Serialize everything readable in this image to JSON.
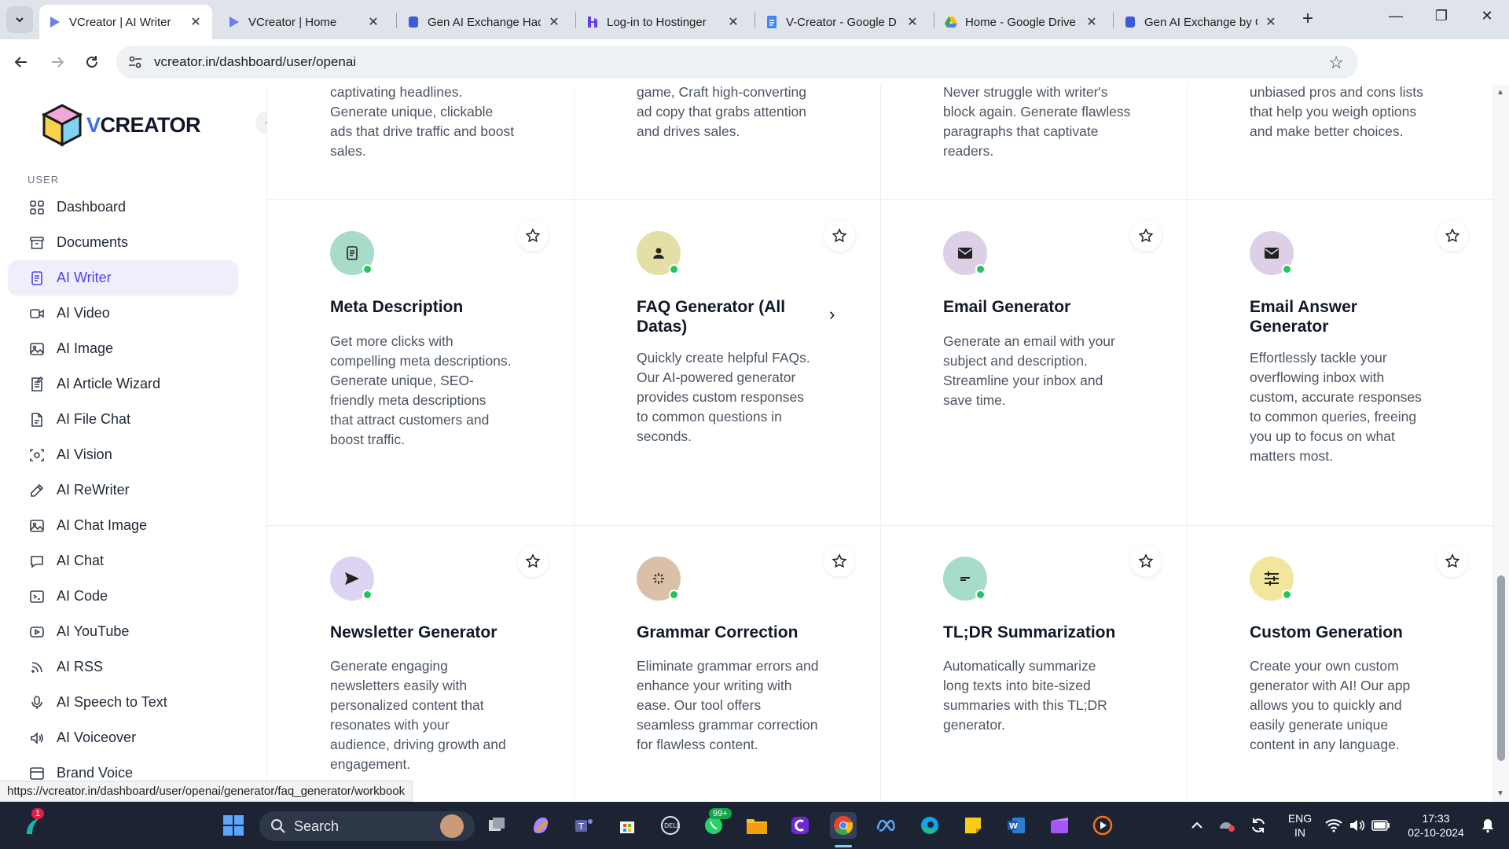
{
  "browser": {
    "tabs": [
      {
        "title": "VCreator | AI Writer",
        "active": true
      },
      {
        "title": "VCreator | Home",
        "active": false
      },
      {
        "title": "Gen AI Exchange Hac",
        "active": false
      },
      {
        "title": "Log-in to Hostinger",
        "active": false
      },
      {
        "title": "V-Creator - Google D",
        "active": false
      },
      {
        "title": "Home - Google Drive",
        "active": false
      },
      {
        "title": "Gen AI Exchange by G",
        "active": false
      }
    ],
    "url": "vcreator.in/dashboard/user/openai",
    "status_url": "https://vcreator.in/dashboard/user/openai/generator/faq_generator/workbook"
  },
  "sidebar": {
    "logo_text": "CREATOR",
    "logo_prefix": "V",
    "section_label": "USER",
    "items": [
      {
        "label": "Dashboard",
        "icon": "grid-icon"
      },
      {
        "label": "Documents",
        "icon": "archive-icon"
      },
      {
        "label": "AI Writer",
        "icon": "document-icon",
        "active": true
      },
      {
        "label": "AI Video",
        "icon": "video-icon"
      },
      {
        "label": "AI Image",
        "icon": "image-icon"
      },
      {
        "label": "AI Article Wizard",
        "icon": "article-icon"
      },
      {
        "label": "AI File Chat",
        "icon": "file-chat-icon"
      },
      {
        "label": "AI Vision",
        "icon": "vision-icon"
      },
      {
        "label": "AI ReWriter",
        "icon": "pen-icon"
      },
      {
        "label": "AI Chat Image",
        "icon": "image-icon"
      },
      {
        "label": "AI Chat",
        "icon": "chat-icon"
      },
      {
        "label": "AI Code",
        "icon": "terminal-icon"
      },
      {
        "label": "AI YouTube",
        "icon": "youtube-icon"
      },
      {
        "label": "AI RSS",
        "icon": "rss-icon"
      },
      {
        "label": "AI Speech to Text",
        "icon": "microphone-icon"
      },
      {
        "label": "AI Voiceover",
        "icon": "speaker-icon"
      },
      {
        "label": "Brand Voice",
        "icon": "brand-icon"
      }
    ]
  },
  "top_row_text": [
    "captivating headlines. Generate unique, clickable ads that drive traffic and boost sales.",
    "game, Craft high-converting ad copy that grabs attention and drives sales.",
    "Never struggle with writer's block again. Generate flawless paragraphs that captivate readers.",
    "unbiased pros and cons lists that help you weigh options and make better choices."
  ],
  "cards": [
    {
      "title": "Meta Description",
      "desc": "Get more clicks with compelling meta descriptions. Generate unique, SEO-friendly meta descriptions that attract customers and boost traffic.",
      "icon": "document-icon",
      "bg": "#a7dcc7"
    },
    {
      "title": "FAQ Generator (All Datas)",
      "desc": "Quickly create helpful FAQs. Our AI-powered generator provides custom responses to common questions in seconds.",
      "icon": "person-icon",
      "bg": "#e3dfa6",
      "arrow": "›"
    },
    {
      "title": "Email Generator",
      "desc": "Generate an email with your subject and description. Streamline your inbox and save time.",
      "icon": "mail-icon",
      "bg": "#ddd0e6"
    },
    {
      "title": "Email Answer Generator",
      "desc": "Effortlessly tackle your overflowing inbox with custom, accurate responses to common queries, freeing you up to focus on what matters most.",
      "icon": "mail-icon",
      "bg": "#ddd0e6"
    },
    {
      "title": "Newsletter Generator",
      "desc": "Generate engaging newsletters easily with personalized content that resonates with your audience, driving growth and engagement.",
      "icon": "send-icon",
      "bg": "#ddd4f3"
    },
    {
      "title": "Grammar Correction",
      "desc": "Eliminate grammar errors and enhance your writing with ease. Our tool offers seamless grammar correction for flawless content.",
      "icon": "sparkle-icon",
      "bg": "#d9c0a6"
    },
    {
      "title": "TL;DR Summarization",
      "desc": "Automatically summarize long texts into bite-sized summaries with this TL;DR generator.",
      "icon": "summary-icon",
      "bg": "#a7dccb"
    },
    {
      "title": "Custom Generation",
      "desc": "Create your own custom generator with AI! Our app allows you to quickly and easily generate unique content in any language.",
      "icon": "sliders-icon",
      "bg": "#f2e59c"
    }
  ],
  "taskbar": {
    "search_label": "Search",
    "whatsapp_badge": "99+",
    "notification_badge": "1",
    "lang_line1": "ENG",
    "lang_line2": "IN",
    "time": "17:33",
    "date": "02-10-2024"
  }
}
